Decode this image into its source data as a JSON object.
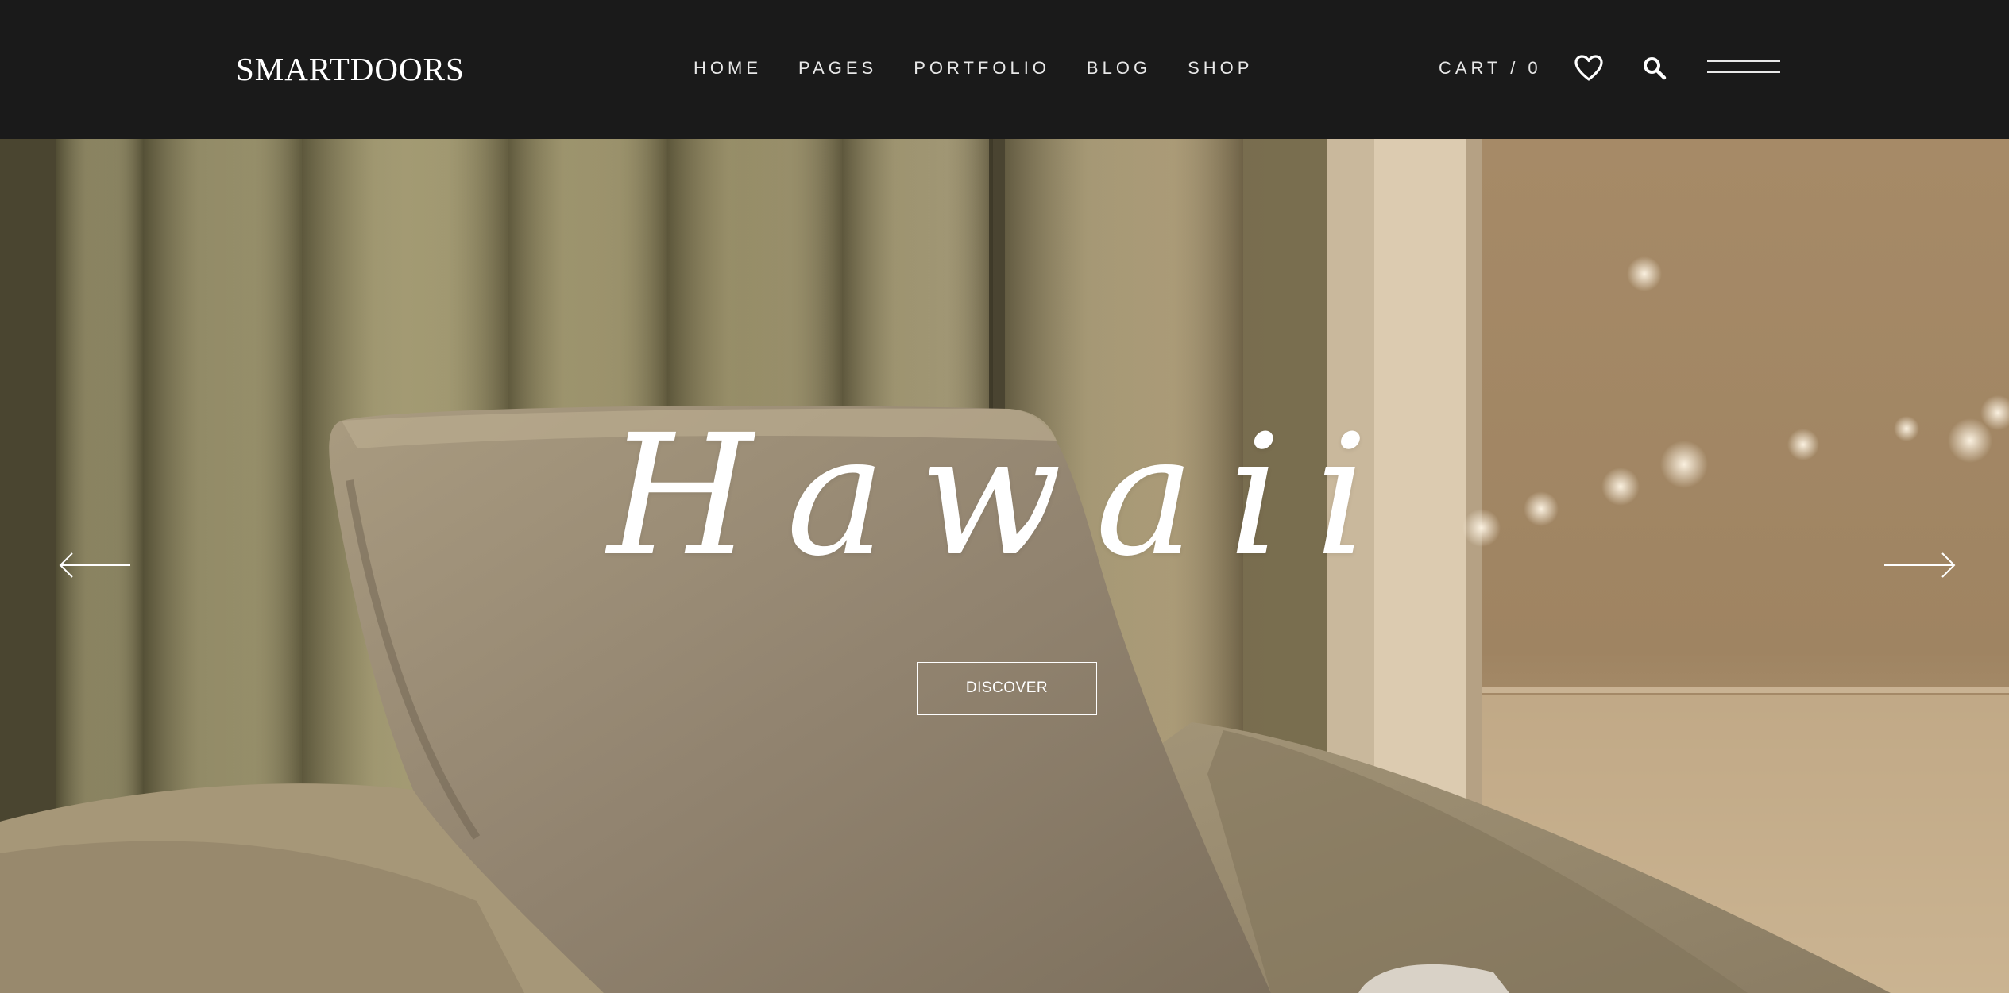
{
  "header": {
    "logo": "SMARTDOORS",
    "nav": [
      {
        "label": "HOME"
      },
      {
        "label": "PAGES"
      },
      {
        "label": "PORTFOLIO"
      },
      {
        "label": "BLOG"
      },
      {
        "label": "SHOP"
      }
    ],
    "cart_label": "CART / 0",
    "icons": {
      "wishlist": "heart-icon",
      "search": "search-icon",
      "menu": "hamburger-menu-icon"
    }
  },
  "hero": {
    "title": "Hawaii",
    "button_label": "DISCOVER",
    "prev_icon": "arrow-left-icon",
    "next_icon": "arrow-right-icon"
  },
  "colors": {
    "header_bg": "#1a1a1a",
    "text": "#ffffff"
  }
}
